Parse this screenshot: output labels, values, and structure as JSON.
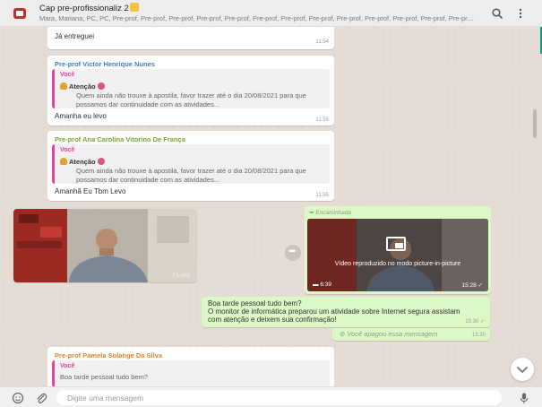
{
  "header": {
    "title": "Cap pre-profissionaliz 2",
    "participants": "Mara, Mariana, PC, PC, Pre-prof, Pre-prof, Pre-prof, Pre-prof, Pre-prof, Pre-prof, Pre-prof, Pre-prof, Pre-prof, Pre-prof, Pre-prof, Pre-prof, Pre-prof, Pre-prof, Pre-prof, Pre-prof, Pre-prof, Pre-prof...",
    "icons": [
      "search-icon",
      "menu-icon"
    ]
  },
  "messages": [
    {
      "text": "Já entreguei",
      "time": "11:54"
    },
    {
      "sender": "Pre-prof Victor Henrique Nunes",
      "sender_color": "#3f7fc0",
      "quote": {
        "author": "Você",
        "heading": "Atenção",
        "line1": "Quem ainda não trouxe à apostila, favor trazer até o dia 20/08/2021 para que",
        "line2": "possamos dar continuidade com as atividades..."
      },
      "text": "Amanha eu levo",
      "time": "11:55"
    },
    {
      "sender": "Pre-prof Ana Carolina Vitorino De França",
      "sender_color": "#6fa72f",
      "quote": {
        "author": "Você",
        "heading": "Atenção",
        "line1": "Quem ainda não trouxe à apostila, favor trazer até o dia 20/08/2021 para que",
        "line2": "possamos dar continuidade com as atividades..."
      },
      "text": "Amanhã Eu Tbm Levo",
      "time": "11:55"
    }
  ],
  "photo": {
    "watermark": "FILMIX"
  },
  "video": {
    "forwarded_label": "Encaminhada",
    "pip_text": "Vídeo reproduzido no modo picture-in-picture",
    "duration": "6:39",
    "time": "15:28"
  },
  "outgoing": {
    "line1": "Boa tarde pessoal tudo bem?",
    "line2": "O monitor de informática preparou um atividade sobre Internet segura assistam",
    "line3": "com atenção e deixem sua confirmação!",
    "time": "15:30"
  },
  "deleted": {
    "text": "Você apagou essa mensagem",
    "time": "15:30"
  },
  "last_message": {
    "sender": "Pre-prof Pamela Solange Da Silva",
    "sender_color": "#e5832a",
    "quote_author": "Você",
    "quote_text": "Boa tarde pessoal tudo bem?"
  },
  "composer": {
    "placeholder": "Digite uma mensagem"
  },
  "colors": {
    "header_bg": "#ededed",
    "chat_bg": "#e5ddd5",
    "outgoing_bubble": "#dcf8c6",
    "incoming_bubble": "#ffffff",
    "accent": "#00a884"
  }
}
